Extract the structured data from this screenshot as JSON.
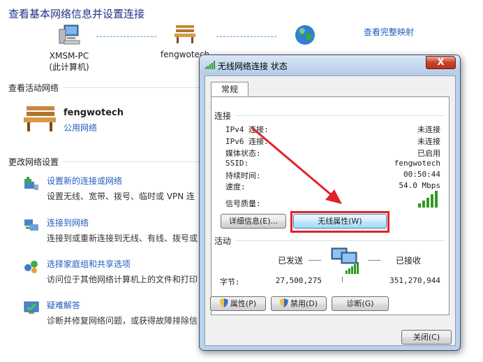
{
  "header": {
    "title": "查看基本网络信息并设置连接",
    "full_map_link": "查看完整映射",
    "nodes": [
      {
        "name": "XMSM-PC",
        "sub": "(此计算机)"
      },
      {
        "name": "fengwotech",
        "sub": ""
      },
      {
        "name": "",
        "sub": ""
      }
    ]
  },
  "active": {
    "heading": "查看活动网络",
    "network_name": "fengwotech",
    "network_type": "公用网络"
  },
  "settings": {
    "heading": "更改网络设置",
    "tasks": [
      {
        "link": "设置新的连接或网络",
        "desc": "设置无线、宽带、拨号、临时或 VPN 连",
        "icon": "new-connection-icon"
      },
      {
        "link": "连接到网络",
        "desc": "连接到或重新连接到无线、有线、拨号或",
        "icon": "connect-network-icon"
      },
      {
        "link": "选择家庭组和共享选项",
        "desc": "访问位于其他网络计算机上的文件和打印",
        "icon": "homegroup-icon"
      },
      {
        "link": "疑难解答",
        "desc": "诊断并修复网络问题，或获得故障排除信",
        "icon": "troubleshoot-icon"
      }
    ]
  },
  "dialog": {
    "title": "无线网络连接 状态",
    "close_symbol": "X",
    "tab": "常规",
    "connection": {
      "heading": "连接",
      "rows": [
        {
          "label": "IPv4 连接:",
          "value": "未连接"
        },
        {
          "label": "IPv6 连接:",
          "value": "未连接"
        },
        {
          "label": "媒体状态:",
          "value": "已启用"
        },
        {
          "label": "SSID:",
          "value": "fengwotech"
        },
        {
          "label": "持续时间:",
          "value": "00:50:44"
        },
        {
          "label": "速度:",
          "value": "54.0 Mbps"
        }
      ],
      "signal_label": "信号质量:",
      "signal_bars": 5,
      "details_button": "详细信息(E)...",
      "wireless_props_button": "无线属性(W)"
    },
    "activity": {
      "heading": "活动",
      "sent_label": "已发送",
      "received_label": "已接收",
      "bytes_label": "字节:",
      "bytes_sent": "27,500,275",
      "bytes_received": "351,270,944"
    },
    "buttons": {
      "properties": "属性(P)",
      "disable": "禁用(D)",
      "diagnose": "诊断(G)",
      "close": "关闭(C)"
    }
  },
  "colors": {
    "link": "#1f5dbb",
    "heading": "#1e3287",
    "annotation_red": "#e0232a",
    "signal_green": "#2e9b24"
  }
}
